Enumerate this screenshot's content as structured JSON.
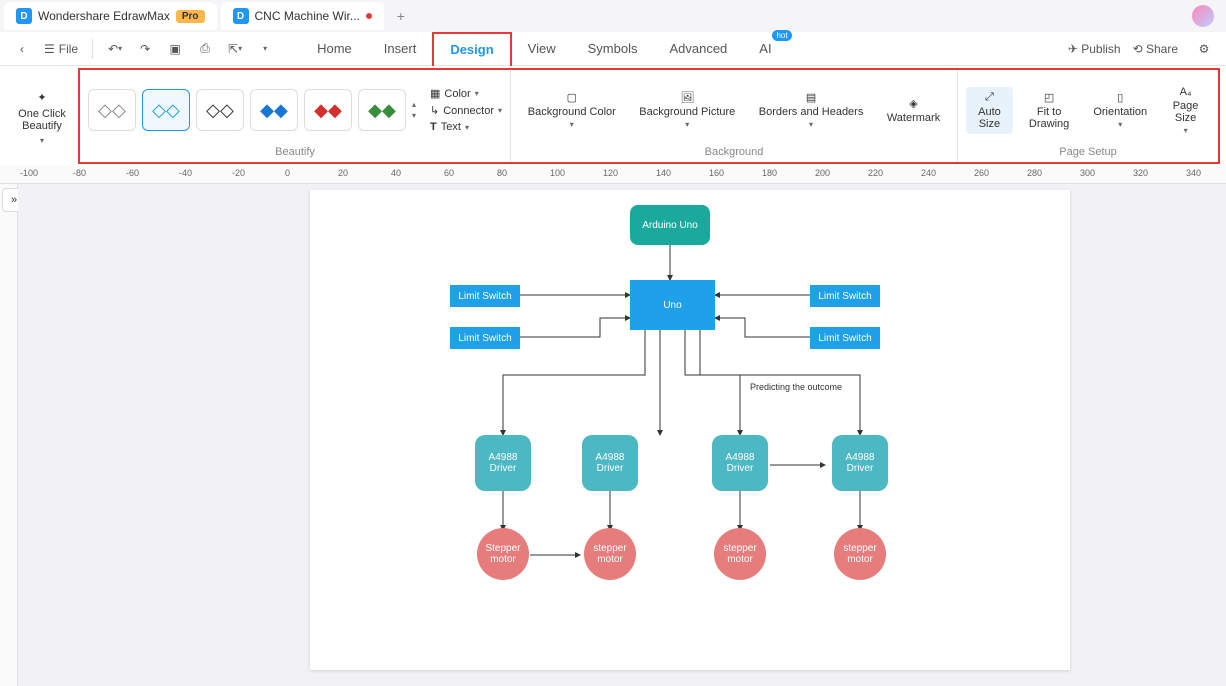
{
  "app": {
    "name": "Wondershare EdrawMax",
    "pro": "Pro",
    "doc_tab": "CNC Machine Wir...",
    "add": "+"
  },
  "menu": {
    "file": "File",
    "back": "‹",
    "home": "Home",
    "insert": "Insert",
    "design": "Design",
    "view": "View",
    "symbols": "Symbols",
    "advanced": "Advanced",
    "ai": "AI",
    "hot": "hot",
    "publish": "Publish",
    "share": "Share"
  },
  "ribbon": {
    "oneclick": "One Click Beautify",
    "beautify_label": "Beautify",
    "color": "Color",
    "connector": "Connector",
    "text": "Text",
    "bgcolor": "Background Color",
    "bgpic": "Background Picture",
    "borders": "Borders and Headers",
    "watermark": "Watermark",
    "background_label": "Background",
    "autosize": "Auto Size",
    "fit": "Fit to Drawing",
    "orientation": "Orientation",
    "pagesize": "Page Size",
    "pagesetup_label": "Page Setup"
  },
  "ruler_marks": [
    "-100",
    "-80",
    "-60",
    "-40",
    "-20",
    "0",
    "20",
    "40",
    "60",
    "80",
    "100",
    "120",
    "140",
    "160",
    "180",
    "200",
    "220",
    "240",
    "260",
    "280",
    "300",
    "320",
    "340"
  ],
  "diagram": {
    "arduino": "Arduino Uno",
    "uno": "Uno",
    "ls1": "Limit Switch",
    "ls2": "Limit Switch",
    "ls3": "Limit Switch",
    "ls4": "Limit Switch",
    "predict": "Predicting the outcome",
    "d1": "A4988 Driver",
    "d2": "A4988 Driver",
    "d3": "A4988 Driver",
    "d4": "A4988 Driver",
    "m1": "Stepper motor",
    "m2": "stepper motor",
    "m3": "stepper motor",
    "m4": "stepper motor"
  }
}
